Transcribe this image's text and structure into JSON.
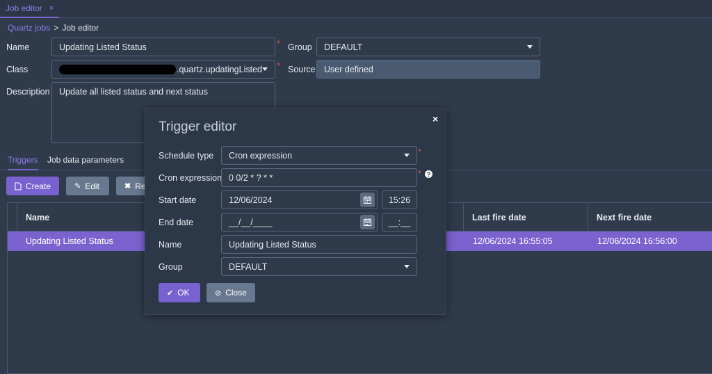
{
  "tab": {
    "label": "Job editor",
    "close": "×"
  },
  "breadcrumb": {
    "root": "Quartz jobs",
    "sep": ">",
    "current": "Job editor"
  },
  "form": {
    "name_label": "Name",
    "name_value": "Updating Listed Status",
    "class_label": "Class",
    "class_value_suffix": ".quartz.updatingListed",
    "description_label": "Description",
    "description_value": "Update all listed status and next status",
    "group_label": "Group",
    "group_value": "DEFAULT",
    "source_label": "Source",
    "source_value": "User defined",
    "required_mark": "*"
  },
  "subtabs": {
    "triggers": "Triggers",
    "job_data": "Job data parameters"
  },
  "toolbar": {
    "create": "Create",
    "edit": "Edit",
    "remove": "Re"
  },
  "grid": {
    "headers": {
      "name": "Name",
      "last_fire": "Last fire date",
      "next_fire": "Next fire date"
    },
    "rows": [
      {
        "name": "Updating Listed Status",
        "last_fire": "12/06/2024 16:55:05",
        "next_fire": "12/06/2024 16:56:00"
      }
    ]
  },
  "modal": {
    "title": "Trigger editor",
    "close": "×",
    "schedule_type_label": "Schedule type",
    "schedule_type_value": "Cron expression",
    "cron_label": "Cron expression",
    "cron_value": "0 0/2 * ? * *",
    "start_date_label": "Start date",
    "start_date_value": "12/06/2024",
    "start_time_value": "15:26",
    "end_date_label": "End date",
    "end_date_value": "__/__/____",
    "end_time_value": "__:__",
    "name_label": "Name",
    "name_value": "Updating Listed Status",
    "group_label": "Group",
    "group_value": "DEFAULT",
    "ok_label": "OK",
    "close_label": "Close",
    "required_mark": "*",
    "help_mark": "?"
  },
  "colors": {
    "accent": "#7862d0",
    "background": "#2f3a4b",
    "required": "#d9534f"
  }
}
